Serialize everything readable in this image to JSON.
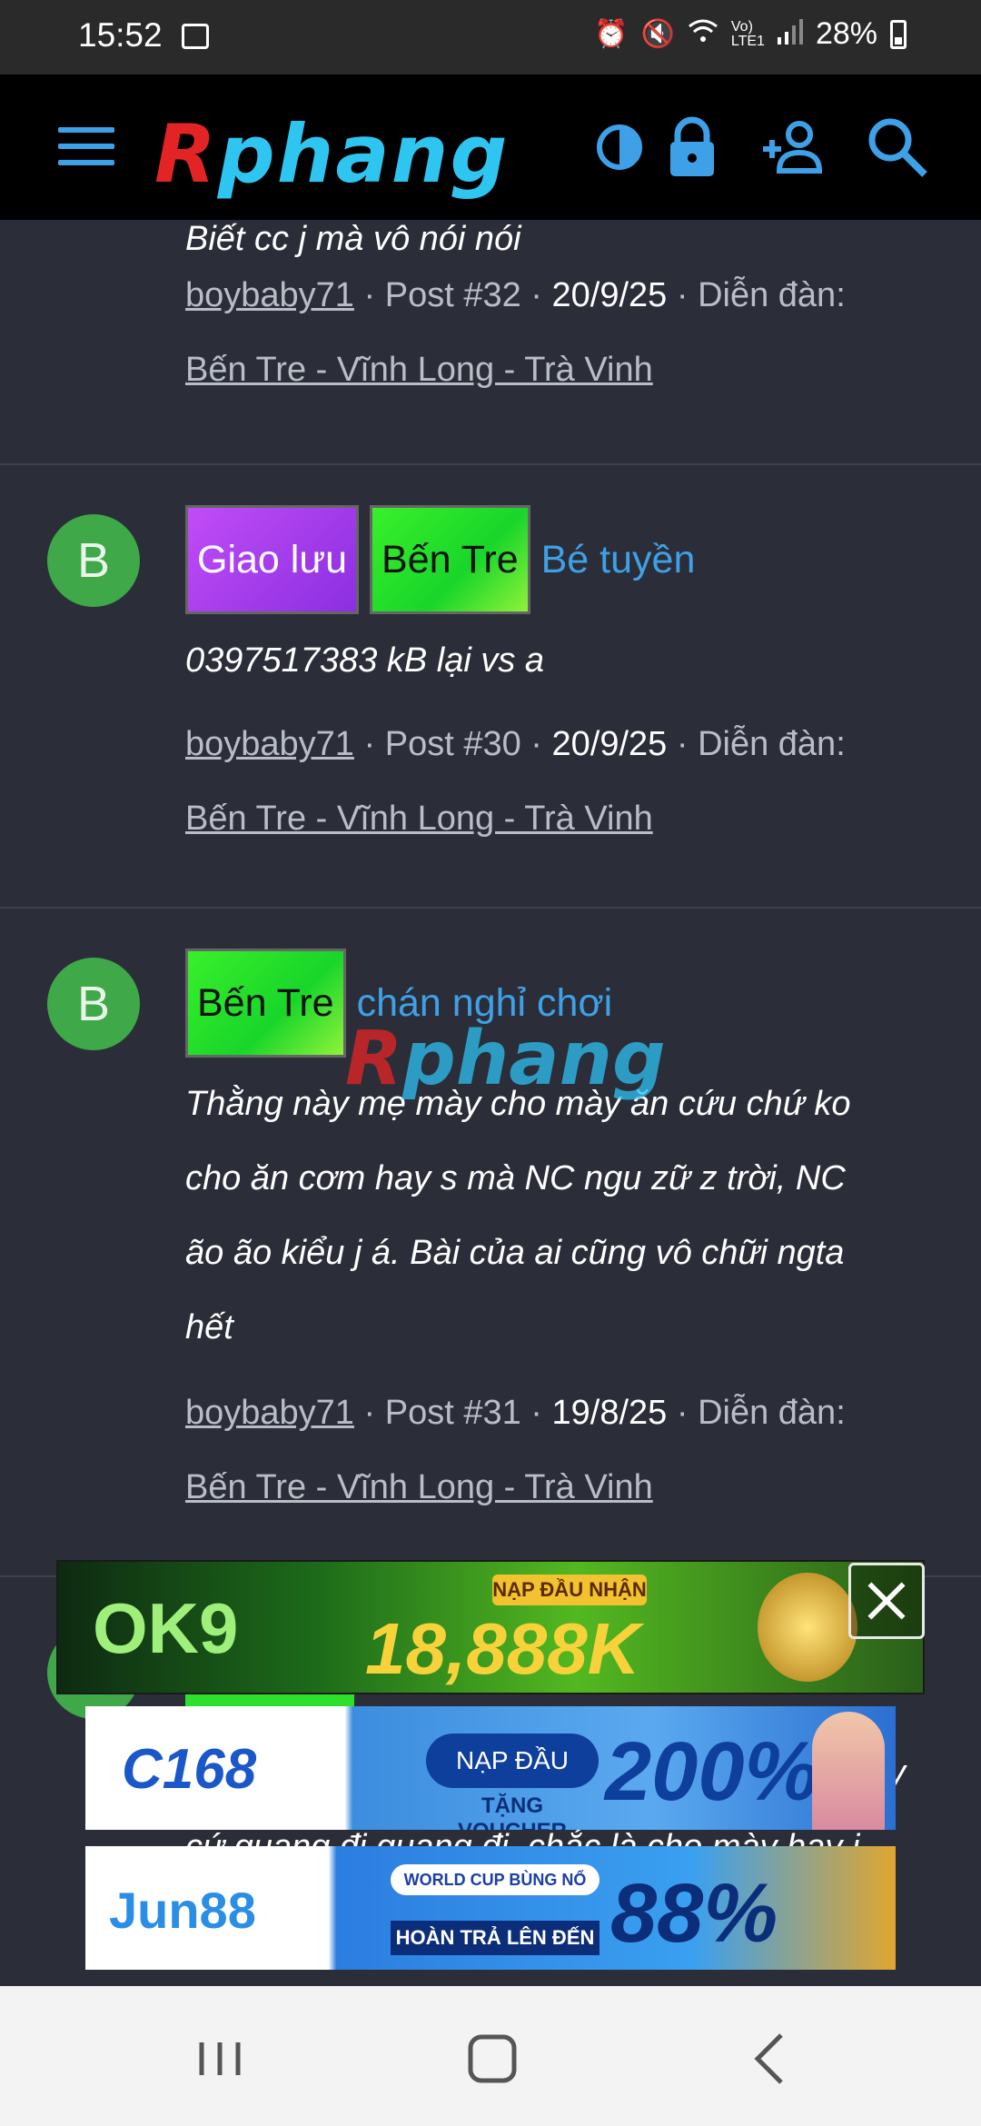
{
  "status_bar": {
    "time": "15:52",
    "battery": "28%",
    "icons": [
      "image-icon",
      "alarm-icon",
      "mute-icon",
      "wifi-icon",
      "volte-icon",
      "signal-icon",
      "battery-icon"
    ]
  },
  "header": {
    "logo_r": "R",
    "logo_rest": "phang",
    "icons": [
      "menu-icon",
      "theme-toggle-icon",
      "lock-icon",
      "register-icon",
      "search-icon"
    ]
  },
  "posts": [
    {
      "snippet": "Biết cc j mà vô nói nói",
      "author": "boybaby71",
      "post_no": "Post #32",
      "date": "20/9/25",
      "forum_label": "Diễn đàn:",
      "forum": "Bến Tre - Vĩnh Long - Trà Vinh"
    },
    {
      "avatar": "B",
      "tags": [
        "Giao lưu",
        "Bến Tre"
      ],
      "title": "Bé tuyền",
      "snippet": "0397517383 kB lại vs a",
      "author": "boybaby71",
      "post_no": "Post #30",
      "date": "20/9/25",
      "forum_label": "Diễn đàn:",
      "forum": "Bến Tre - Vĩnh Long - Trà Vinh"
    },
    {
      "avatar": "B",
      "tags": [
        "Bến Tre"
      ],
      "title": "chán nghỉ chơi",
      "snippet_lines": [
        "Thằng này mẹ mày cho mày ăn cứu chứ ko",
        "cho ăn cơm hay s mà NC ngu zữ z trời, NC",
        "ão ão kiểu j á. Bài của ai cũng vô chữi ngta",
        "hết"
      ],
      "author": "boybaby71",
      "post_no": "Post #31",
      "date": "19/8/25",
      "forum_label": "Diễn đàn:",
      "forum": "Bến Tre - Vĩnh Long - Trà Vinh"
    }
  ],
  "partial_post": {
    "line_a": "y",
    "line_b": "cứ quang đi quang đi, chắc là cho mày hay j"
  },
  "watermark": {
    "r": "R",
    "rest": "phang"
  },
  "ads": {
    "ok9": {
      "logo": "OK9",
      "badge": "NẠP ĐẦU NHẬN",
      "amount": "18,888K"
    },
    "c168": {
      "logo": "C168",
      "button": "NẠP ĐẦU",
      "sub": "TẶNG VOUCHER",
      "percent": "200%"
    },
    "jun88": {
      "logo": "Jun88",
      "top": "WORLD CUP BÙNG NỔ",
      "bottom": "HOÀN TRẢ LÊN ĐẾN",
      "percent": "88%"
    }
  },
  "nav": [
    "recent-apps-icon",
    "home-icon",
    "back-icon"
  ]
}
